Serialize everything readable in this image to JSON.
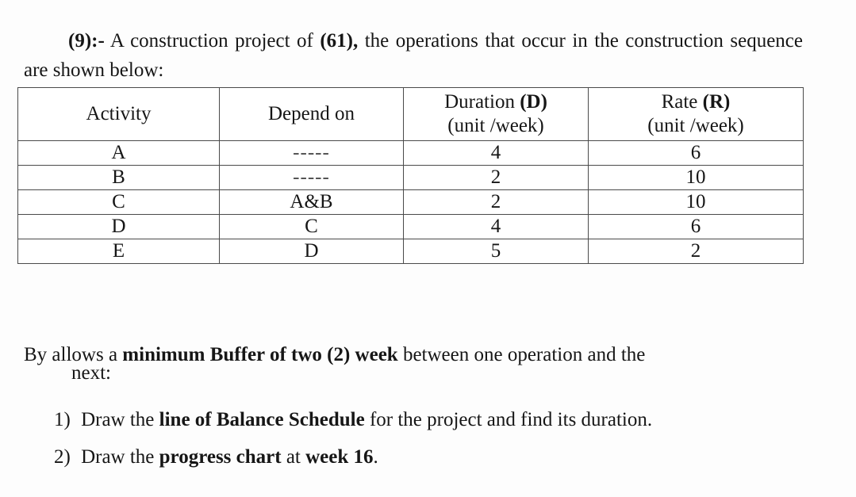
{
  "document": {
    "intro": {
      "number": "(9):-",
      "text_part1": " A construction project of ",
      "quantity": "(61),",
      "text_part2": " the operations that occur in the construction sequence are shown below:"
    },
    "table": {
      "columns": [
        {
          "line1": "Activity",
          "line2": ""
        },
        {
          "line1": "Depend on",
          "line2": ""
        },
        {
          "line1_plain": "Duration ",
          "line1_bold": "(D)",
          "line2": "(unit /week)"
        },
        {
          "line1_plain": "Rate ",
          "line1_bold": "(R)",
          "line2": "(unit /week)"
        }
      ],
      "rows": [
        {
          "activity": "A",
          "depend_on": "-----",
          "duration": "4",
          "rate": "6"
        },
        {
          "activity": "B",
          "depend_on": "-----",
          "duration": "2",
          "rate": "10"
        },
        {
          "activity": "C",
          "depend_on": "A&B",
          "duration": "2",
          "rate": "10"
        },
        {
          "activity": "D",
          "depend_on": "C",
          "duration": "4",
          "rate": "6"
        },
        {
          "activity": "E",
          "depend_on": "D",
          "duration": "5",
          "rate": "2"
        }
      ]
    },
    "buffer_note": {
      "lead": "By allows a ",
      "emphasis": "minimum Buffer of two (2) week",
      "trail": " between one operation and the",
      "continuation": "next:"
    },
    "questions": [
      {
        "number": "1)",
        "lead": " Draw the ",
        "emphasis": "line of Balance Schedule",
        "trail": " for the project and find its duration."
      },
      {
        "number": "2)",
        "lead": " Draw the ",
        "emphasis": "progress chart",
        "trail_plain": " at ",
        "emphasis2": "week 16",
        "trail": "."
      }
    ]
  }
}
